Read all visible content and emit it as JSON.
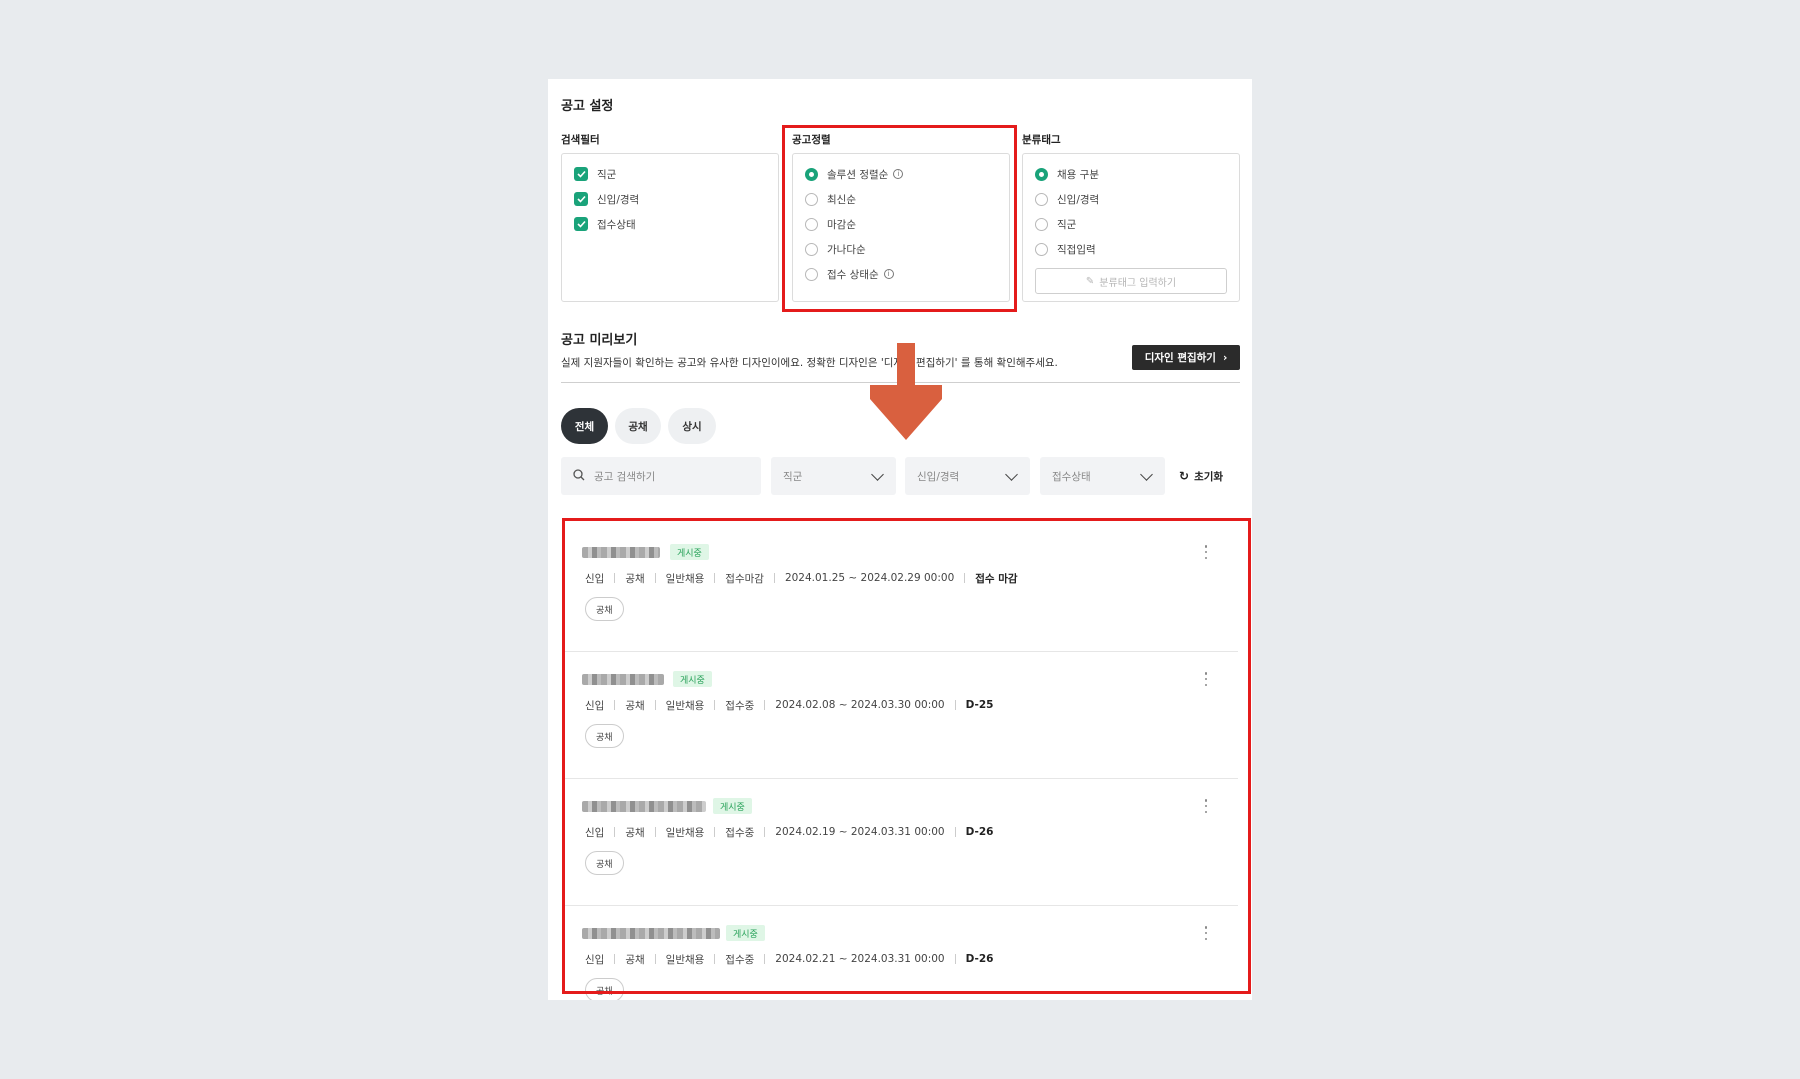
{
  "settings": {
    "title": "공고 설정",
    "filter_label": "검색필터",
    "filters": [
      "직군",
      "신입/경력",
      "접수상태"
    ],
    "sort_label": "공고정렬",
    "sort_options": [
      "솔루션 정렬순",
      "최신순",
      "마감순",
      "가나다순",
      "접수 상태순"
    ],
    "sort_selected": "솔루션 정렬순",
    "tag_label": "분류태그",
    "tag_options": [
      "채용 구분",
      "신입/경력",
      "직군",
      "직접입력"
    ],
    "tag_selected": "채용 구분",
    "tag_input_placeholder": "분류태그 입력하기"
  },
  "preview": {
    "title": "공고 미리보기",
    "description": "실제 지원자들이 확인하는 공고와 유사한 디자인이에요. 정확한 디자인은 '디자인 편집하기' 를 통해 확인해주세요.",
    "edit_button": "디자인 편집하기",
    "tabs": [
      "전체",
      "공채",
      "상시"
    ],
    "active_tab": "전체",
    "search_placeholder": "공고 검색하기",
    "dropdowns": [
      "직군",
      "신입/경력",
      "접수상태"
    ],
    "reset_label": "초기화"
  },
  "postings": [
    {
      "badge": "게시중",
      "meta": [
        "신입",
        "공채",
        "일반채용",
        "접수마감",
        "2024.01.25 ~ 2024.02.29 00:00"
      ],
      "status": "접수 마감",
      "chip": "공채"
    },
    {
      "badge": "게시중",
      "meta": [
        "신입",
        "공채",
        "일반채용",
        "접수중",
        "2024.02.08 ~ 2024.03.30 00:00"
      ],
      "status": "D-25",
      "chip": "공채"
    },
    {
      "badge": "게시중",
      "meta": [
        "신입",
        "공채",
        "일반채용",
        "접수중",
        "2024.02.19 ~ 2024.03.31 00:00"
      ],
      "status": "D-26",
      "chip": "공채"
    },
    {
      "badge": "게시중",
      "meta": [
        "신입",
        "공채",
        "일반채용",
        "접수중",
        "2024.02.21 ~ 2024.03.31 00:00"
      ],
      "status": "D-26",
      "chip": "공채"
    }
  ],
  "colors": {
    "accent": "#1aa37a",
    "highlight": "#e41b1b",
    "arrow": "#d9603f"
  }
}
